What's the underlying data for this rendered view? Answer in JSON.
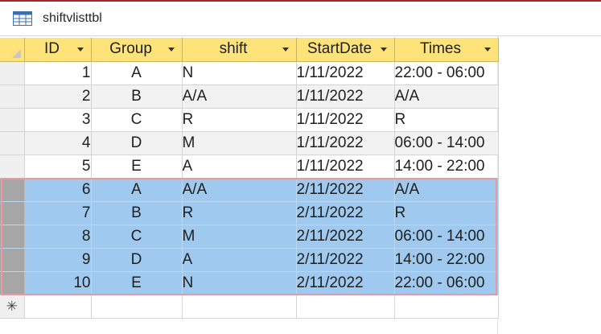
{
  "window": {
    "title": "shiftvlisttbl",
    "icon": "table-icon"
  },
  "columns": [
    "ID",
    "Group",
    "shift",
    "StartDate",
    "Times"
  ],
  "rows": [
    {
      "id": "1",
      "group": "A",
      "shift": "N",
      "start": "1/11/2022",
      "times": "22:00 - 06:00"
    },
    {
      "id": "2",
      "group": "B",
      "shift": "A/A",
      "start": "1/11/2022",
      "times": "A/A"
    },
    {
      "id": "3",
      "group": "C",
      "shift": "R",
      "start": "1/11/2022",
      "times": "R"
    },
    {
      "id": "4",
      "group": "D",
      "shift": "M",
      "start": "1/11/2022",
      "times": "06:00 - 14:00"
    },
    {
      "id": "5",
      "group": "E",
      "shift": "A",
      "start": "1/11/2022",
      "times": "14:00 - 22:00"
    },
    {
      "id": "6",
      "group": "A",
      "shift": "A/A",
      "start": "2/11/2022",
      "times": "A/A"
    },
    {
      "id": "7",
      "group": "B",
      "shift": "R",
      "start": "2/11/2022",
      "times": "R"
    },
    {
      "id": "8",
      "group": "C",
      "shift": "M",
      "start": "2/11/2022",
      "times": "06:00 - 14:00"
    },
    {
      "id": "9",
      "group": "D",
      "shift": "A",
      "start": "2/11/2022",
      "times": "14:00 - 22:00"
    },
    {
      "id": "10",
      "group": "E",
      "shift": "N",
      "start": "2/11/2022",
      "times": "22:00 - 06:00"
    }
  ],
  "new_record_marker": "✳",
  "colors": {
    "header": "#fde37a",
    "selected_rows": "#9fc9ee",
    "selection_outline": "#e89aa0",
    "accent_line": "#a4262c"
  }
}
